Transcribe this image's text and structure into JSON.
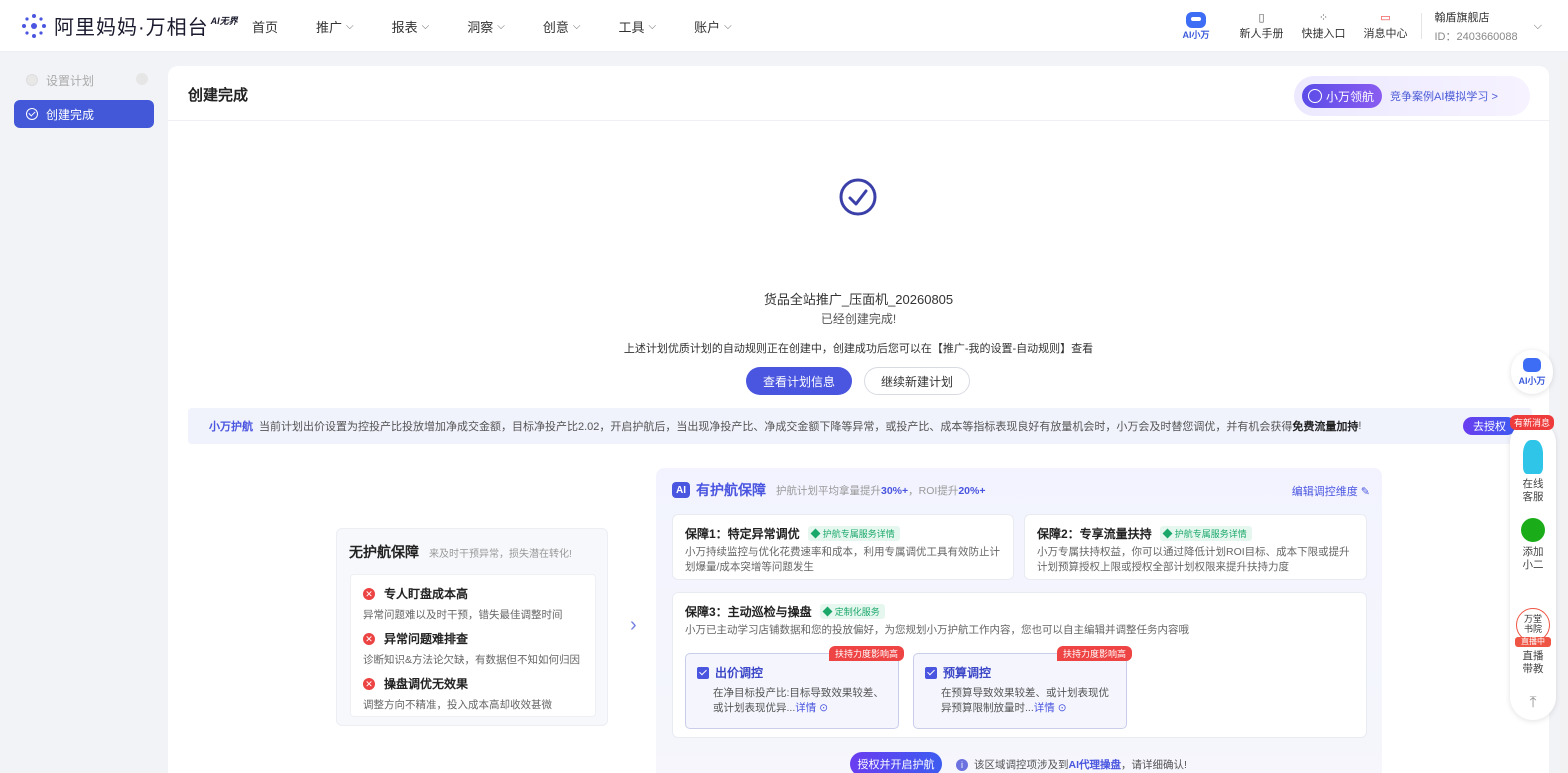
{
  "header": {
    "logo_text": "阿里妈妈·万相台",
    "logo_sub": "AI无界",
    "nav": [
      {
        "label": "首页",
        "has_menu": false
      },
      {
        "label": "推广",
        "has_menu": true
      },
      {
        "label": "报表",
        "has_menu": true
      },
      {
        "label": "洞察",
        "has_menu": true
      },
      {
        "label": "创意",
        "has_menu": true
      },
      {
        "label": "工具",
        "has_menu": true
      },
      {
        "label": "账户",
        "has_menu": true
      }
    ],
    "ai_label": "AI小万",
    "tools": [
      {
        "label": "新人手册",
        "icon": "book-icon"
      },
      {
        "label": "快捷入口",
        "icon": "grid-icon"
      },
      {
        "label": "消息中心",
        "icon": "message-icon"
      }
    ],
    "account_name": "翰盾旗舰店",
    "account_id": "ID：2403660088"
  },
  "sidebar": {
    "items": [
      {
        "label": "设置计划",
        "state": "disabled"
      },
      {
        "label": "创建完成",
        "state": "active"
      }
    ]
  },
  "main": {
    "title": "创建完成",
    "pilot_tag": "小万领航",
    "pilot_link": "竞争案例AI模拟学习 >",
    "plan_name": "货品全站推广_压面机_20260805",
    "plan_done": "已经创建完成!",
    "plan_note": "上述计划优质计划的自动规则正在创建中，创建成功后您可以在【推广-我的设置-自动规则】查看",
    "btn_view": "查看计划信息",
    "btn_new": "继续新建计划",
    "banner_tag": "小万护航",
    "banner_text": "当前计划出价设置为控投产比投放增加净成交金额，目标净投产比2.02，开启护航后，当出现净投产比、净成交金额下降等异常，或投产比、成本等指标表现良好有放量机会时，小万会及时替您调优，并有机会获得",
    "banner_bold": "免费流量加持",
    "banner_end": "!",
    "banner_btn": "去授权"
  },
  "no_pilot": {
    "title": "无护航保障",
    "subtitle": "来及时干预异常，损失潜在转化!",
    "items": [
      {
        "title": "专人盯盘成本高",
        "desc": "异常问题难以及时干预，错失最佳调整时间"
      },
      {
        "title": "异常问题难排查",
        "desc": "诊断知识&方法论欠缺，有数据但不知如何归因"
      },
      {
        "title": "操盘调优无效果",
        "desc": "调整方向不精准，投入成本高却收效甚微"
      }
    ]
  },
  "pilot": {
    "badge": "AI",
    "title": "有护航保障",
    "desc_pre": "护航计划平均拿量提升",
    "desc_v1": "30%+",
    "desc_mid": "，ROI提升",
    "desc_v2": "20%+",
    "edit": "编辑调控维度",
    "g1": {
      "title": "保障1：特定异常调优",
      "tag": "护航专属服务详情",
      "desc1": "小万持续监控与优化花费速率和成本，利用专属调优工具有效防止计",
      "desc2": "划爆量/成本突增等问题发生"
    },
    "g2": {
      "title": "保障2：专享流量扶持",
      "tag": "护航专属服务详情",
      "desc1": "小万专属扶持权益，你可以通过降低计划ROI目标、成本下限或提升",
      "desc2": "计划预算授权上限或授权全部计划权限来提升扶持力度"
    },
    "g3": {
      "title": "保障3：主动巡检与操盘",
      "tag": "定制化服务",
      "desc": "小万已主动学习店铺数据和您的投放偏好，为您规划小万护航工作内容，您也可以自主编辑并调整任务内容哦"
    },
    "sub": [
      {
        "title": "出价调控",
        "ribbon": "扶持力度影响高",
        "desc1": "在净目标投产比:目标导致效果较差、",
        "desc2": "或计划表现优异...",
        "link": "详情"
      },
      {
        "title": "预算调控",
        "ribbon": "扶持力度影响高",
        "desc1": "在预算导致效果较差、或计划表现优",
        "desc2": "异预算限制放量时...",
        "link": "详情"
      }
    ],
    "auth_btn": "授权并开启护航",
    "note_pre": "该区域调控项涉及到",
    "note_bold": "AI代理操盘",
    "note_post": "，请详细确认!"
  },
  "float": {
    "ai_label": "AI小万",
    "new_msg": "有新消息",
    "items": [
      {
        "label1": "在线",
        "label2": "客服"
      },
      {
        "label1": "添加",
        "label2": "小二"
      },
      {
        "label1": "直播",
        "label2": "带教"
      }
    ],
    "live_badge_top": "万堂",
    "live_badge_mid": "书院",
    "live_badge_tag": "直播中"
  },
  "colors": {
    "accent": "#4a55e0",
    "danger": "#ec4343",
    "success": "#1aa86a"
  }
}
